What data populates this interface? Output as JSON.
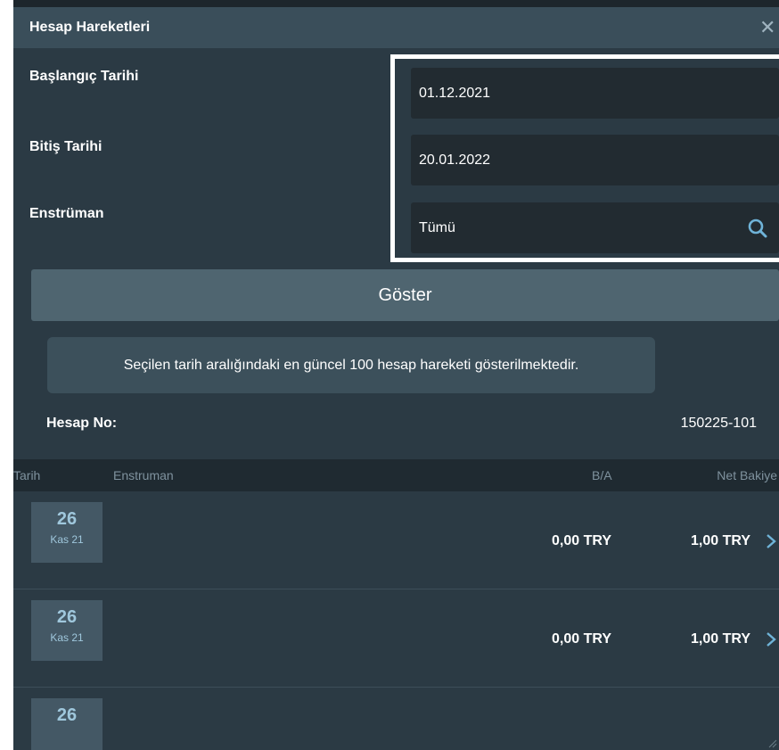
{
  "window": {
    "title": "Hesap Hareketleri",
    "close_icon": "close-icon"
  },
  "form": {
    "start_date_label": "Başlangıç Tarihi",
    "start_date_value": "01.12.2021",
    "end_date_label": "Bitiş Tarihi",
    "end_date_value": "20.01.2022",
    "instrument_label": "Enstrüman",
    "instrument_value": "Tümü",
    "search_icon": "search-icon"
  },
  "show_button_label": "Göster",
  "info_text": "Seçilen tarih aralığındaki en güncel 100 hesap hareketi gösterilmektedir.",
  "account": {
    "label": "Hesap No:",
    "value": "150225-101"
  },
  "table": {
    "headers": {
      "date": "Tarih",
      "instrument": "Enstruman",
      "ba": "B/A",
      "balance": "Net Bakiye"
    },
    "rows": [
      {
        "day": "26",
        "month": "Kas 21",
        "ba": "0,00 TRY",
        "balance": "1,00 TRY"
      },
      {
        "day": "26",
        "month": "Kas 21",
        "ba": "0,00 TRY",
        "balance": "1,00 TRY"
      },
      {
        "day": "26",
        "month": "",
        "ba": "",
        "balance": ""
      }
    ]
  },
  "colors": {
    "window_bg": "#2b3a44",
    "titlebar_bg": "#3a4e5a",
    "field_bg": "#222b31",
    "button_bg": "#4f6570",
    "date_badge_bg": "#445865",
    "accent": "#9fc7dc"
  }
}
